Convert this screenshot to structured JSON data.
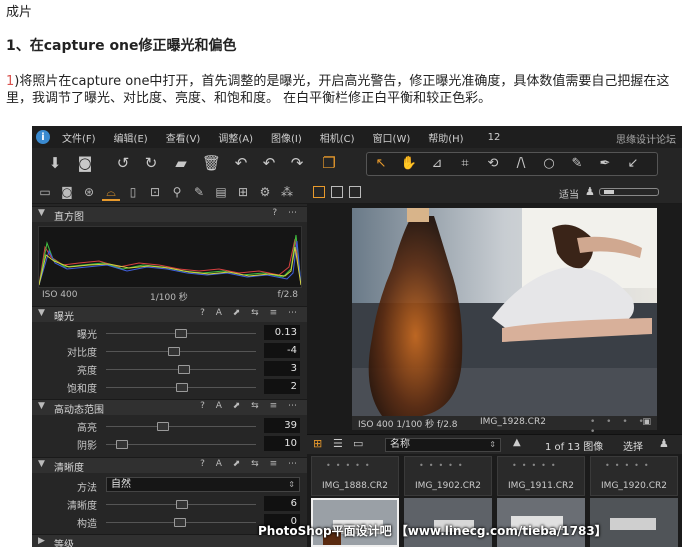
{
  "article": {
    "line1": "成片",
    "line2": "1、在capture one修正曝光和偏色",
    "para_num": "1",
    "para_text": ")将照片在capture one中打开，首先调整的是曝光，开启高光警告，修正曝光准确度，具体数值需要自己把握在这里，我调节了曝光、对比度、亮度、和饱和度。 在白平衡栏修正白平衡和较正色彩。"
  },
  "app": {
    "logo": "i",
    "menu": [
      "文件(F)",
      "编辑(E)",
      "查看(V)",
      "调整(A)",
      "图像(I)",
      "相机(C)",
      "窗口(W)",
      "帮助(H)"
    ],
    "menu_number": "12",
    "brand": "思缘设计论坛"
  },
  "histogram": {
    "title": "直方图",
    "iso": "ISO 400",
    "shutter": "1/100 秒",
    "aperture": "f/2.8"
  },
  "exposure": {
    "title": "曝光",
    "rows": [
      {
        "label": "曝光",
        "value": "0.13",
        "pos": 0.5
      },
      {
        "label": "对比度",
        "value": "-4",
        "pos": 0.45
      },
      {
        "label": "亮度",
        "value": "3",
        "pos": 0.52
      },
      {
        "label": "饱和度",
        "value": "2",
        "pos": 0.51
      }
    ]
  },
  "hdr": {
    "title": "高动态范围",
    "rows": [
      {
        "label": "高亮",
        "value": "39",
        "pos": 0.37
      },
      {
        "label": "阴影",
        "value": "10",
        "pos": 0.07
      }
    ]
  },
  "clarity": {
    "title": "清晰度",
    "method_label": "方法",
    "method_value": "自然",
    "rows": [
      {
        "label": "清晰度",
        "value": "6",
        "pos": 0.51
      },
      {
        "label": "构造",
        "value": "0",
        "pos": 0.49
      }
    ]
  },
  "levels": {
    "title": "等级"
  },
  "section_icons": "? A ⬈ ⇆ ≡ ⋯",
  "viewer": {
    "fit": "适当",
    "caption_exif": "ISO 400 1/100 秒 f/2.8",
    "caption_file": "IMG_1928.CR2"
  },
  "browser": {
    "sort": "名称",
    "count": "1 of 13 图像",
    "select": "选择",
    "thumbs": [
      "IMG_1888.CR2",
      "IMG_1902.CR2",
      "IMG_1911.CR2",
      "IMG_1920.CR2"
    ]
  },
  "watermark": "PhotoShop平面设计吧 【www.linecg.com/tieba/1783】",
  "colors": {
    "accent": "#e89a2c",
    "panel": "#262626",
    "toolbar": "#252525",
    "menubar": "#1e1e1e"
  }
}
